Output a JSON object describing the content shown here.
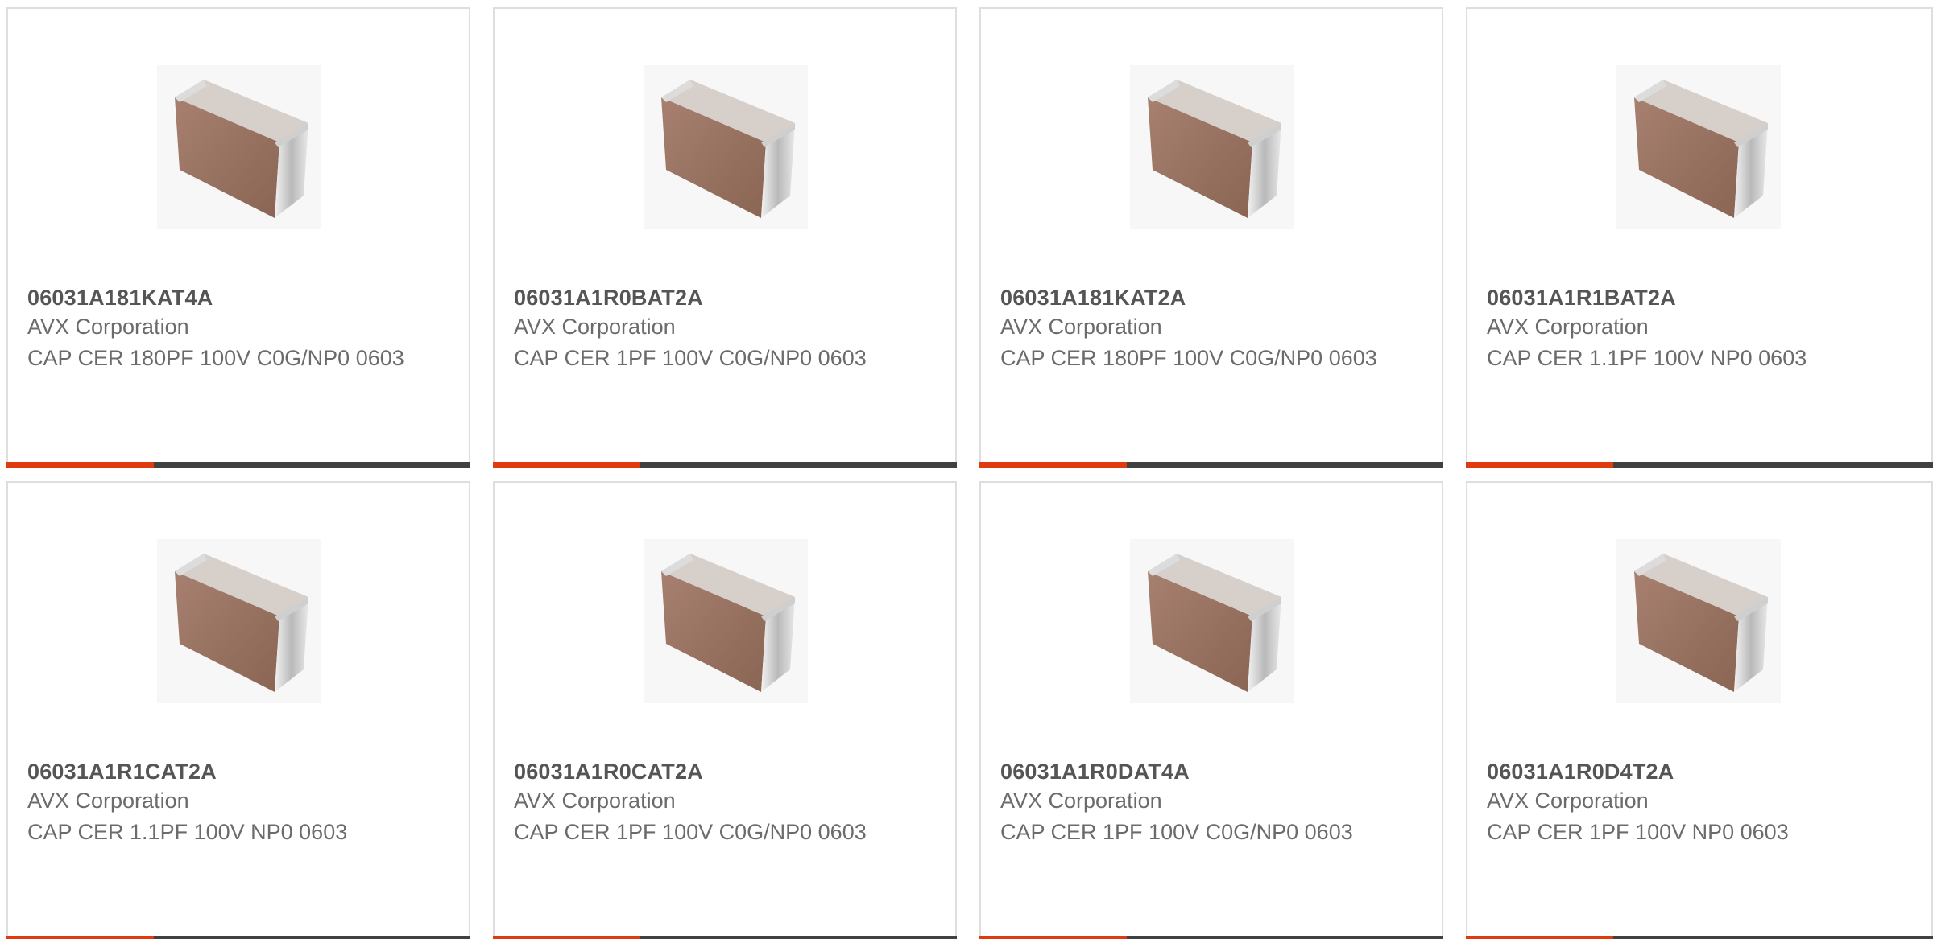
{
  "products": [
    {
      "part_number": "06031A181KAT4A",
      "manufacturer": "AVX Corporation",
      "description": "CAP CER 180PF 100V C0G/NP0 0603",
      "image_icon": "ceramic-capacitor-chip-icon"
    },
    {
      "part_number": "06031A1R0BAT2A",
      "manufacturer": "AVX Corporation",
      "description": "CAP CER 1PF 100V C0G/NP0 0603",
      "image_icon": "ceramic-capacitor-chip-icon"
    },
    {
      "part_number": "06031A181KAT2A",
      "manufacturer": "AVX Corporation",
      "description": "CAP CER 180PF 100V C0G/NP0 0603",
      "image_icon": "ceramic-capacitor-chip-icon"
    },
    {
      "part_number": "06031A1R1BAT2A",
      "manufacturer": "AVX Corporation",
      "description": "CAP CER 1.1PF 100V NP0 0603",
      "image_icon": "ceramic-capacitor-chip-icon"
    },
    {
      "part_number": "06031A1R1CAT2A",
      "manufacturer": "AVX Corporation",
      "description": "CAP CER 1.1PF 100V NP0 0603",
      "image_icon": "ceramic-capacitor-chip-icon"
    },
    {
      "part_number": "06031A1R0CAT2A",
      "manufacturer": "AVX Corporation",
      "description": "CAP CER 1PF 100V C0G/NP0 0603",
      "image_icon": "ceramic-capacitor-chip-icon"
    },
    {
      "part_number": "06031A1R0DAT4A",
      "manufacturer": "AVX Corporation",
      "description": "CAP CER 1PF 100V C0G/NP0 0603",
      "image_icon": "ceramic-capacitor-chip-icon"
    },
    {
      "part_number": "06031A1R0D4T2A",
      "manufacturer": "AVX Corporation",
      "description": "CAP CER 1PF 100V NP0 0603",
      "image_icon": "ceramic-capacitor-chip-icon"
    }
  ],
  "colors": {
    "accent": "#e03a0f",
    "bar": "#414141",
    "border": "#dedede",
    "text": "#6b6b6b",
    "part_text": "#555555"
  }
}
